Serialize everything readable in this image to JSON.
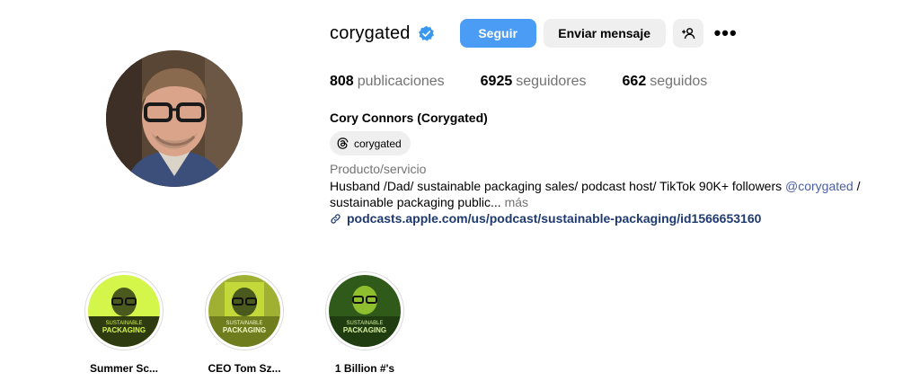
{
  "profile": {
    "username": "corygated",
    "follow_label": "Seguir",
    "message_label": "Enviar mensaje",
    "add_user_icon": "add-user-icon",
    "more_label": "•••",
    "stats": {
      "posts_value": "808",
      "posts_label": "publicaciones",
      "followers_value": "6925",
      "followers_label": "seguidores",
      "following_value": "662",
      "following_label": "seguidos"
    },
    "full_name": "Cory Connors (Corygated)",
    "threads_handle": "corygated",
    "category": "Producto/servicio",
    "bio_text": "Husband /Dad/ sustainable packaging sales/ podcast host/ TikTok 90K+ followers ",
    "bio_mention": "@corygated",
    "bio_text_2": " / sustainable packaging public... ",
    "bio_more": "más",
    "link": "podcasts.apple.com/us/podcast/sustainable-packaging/id1566653160"
  },
  "highlights": [
    {
      "label": "Summer Sc...",
      "cover_title": "SUSTAINABLE",
      "cover_subtitle": "PACKAGING",
      "accent": "#d4f54a"
    },
    {
      "label": "CEO Tom Sz...",
      "cover_title": "SUSTAINABLE",
      "cover_subtitle": "PACKAGING",
      "accent": "#c3d93a"
    },
    {
      "label": "1 Billion #'s",
      "cover_title": "SUSTAINABLE",
      "cover_subtitle": "PACKAGING",
      "accent": "#8fbf2e"
    }
  ],
  "colors": {
    "follow_button": "#4b9cf4",
    "secondary_button": "#efefef",
    "verified": "#3897f0",
    "link": "#1e3a6f"
  }
}
